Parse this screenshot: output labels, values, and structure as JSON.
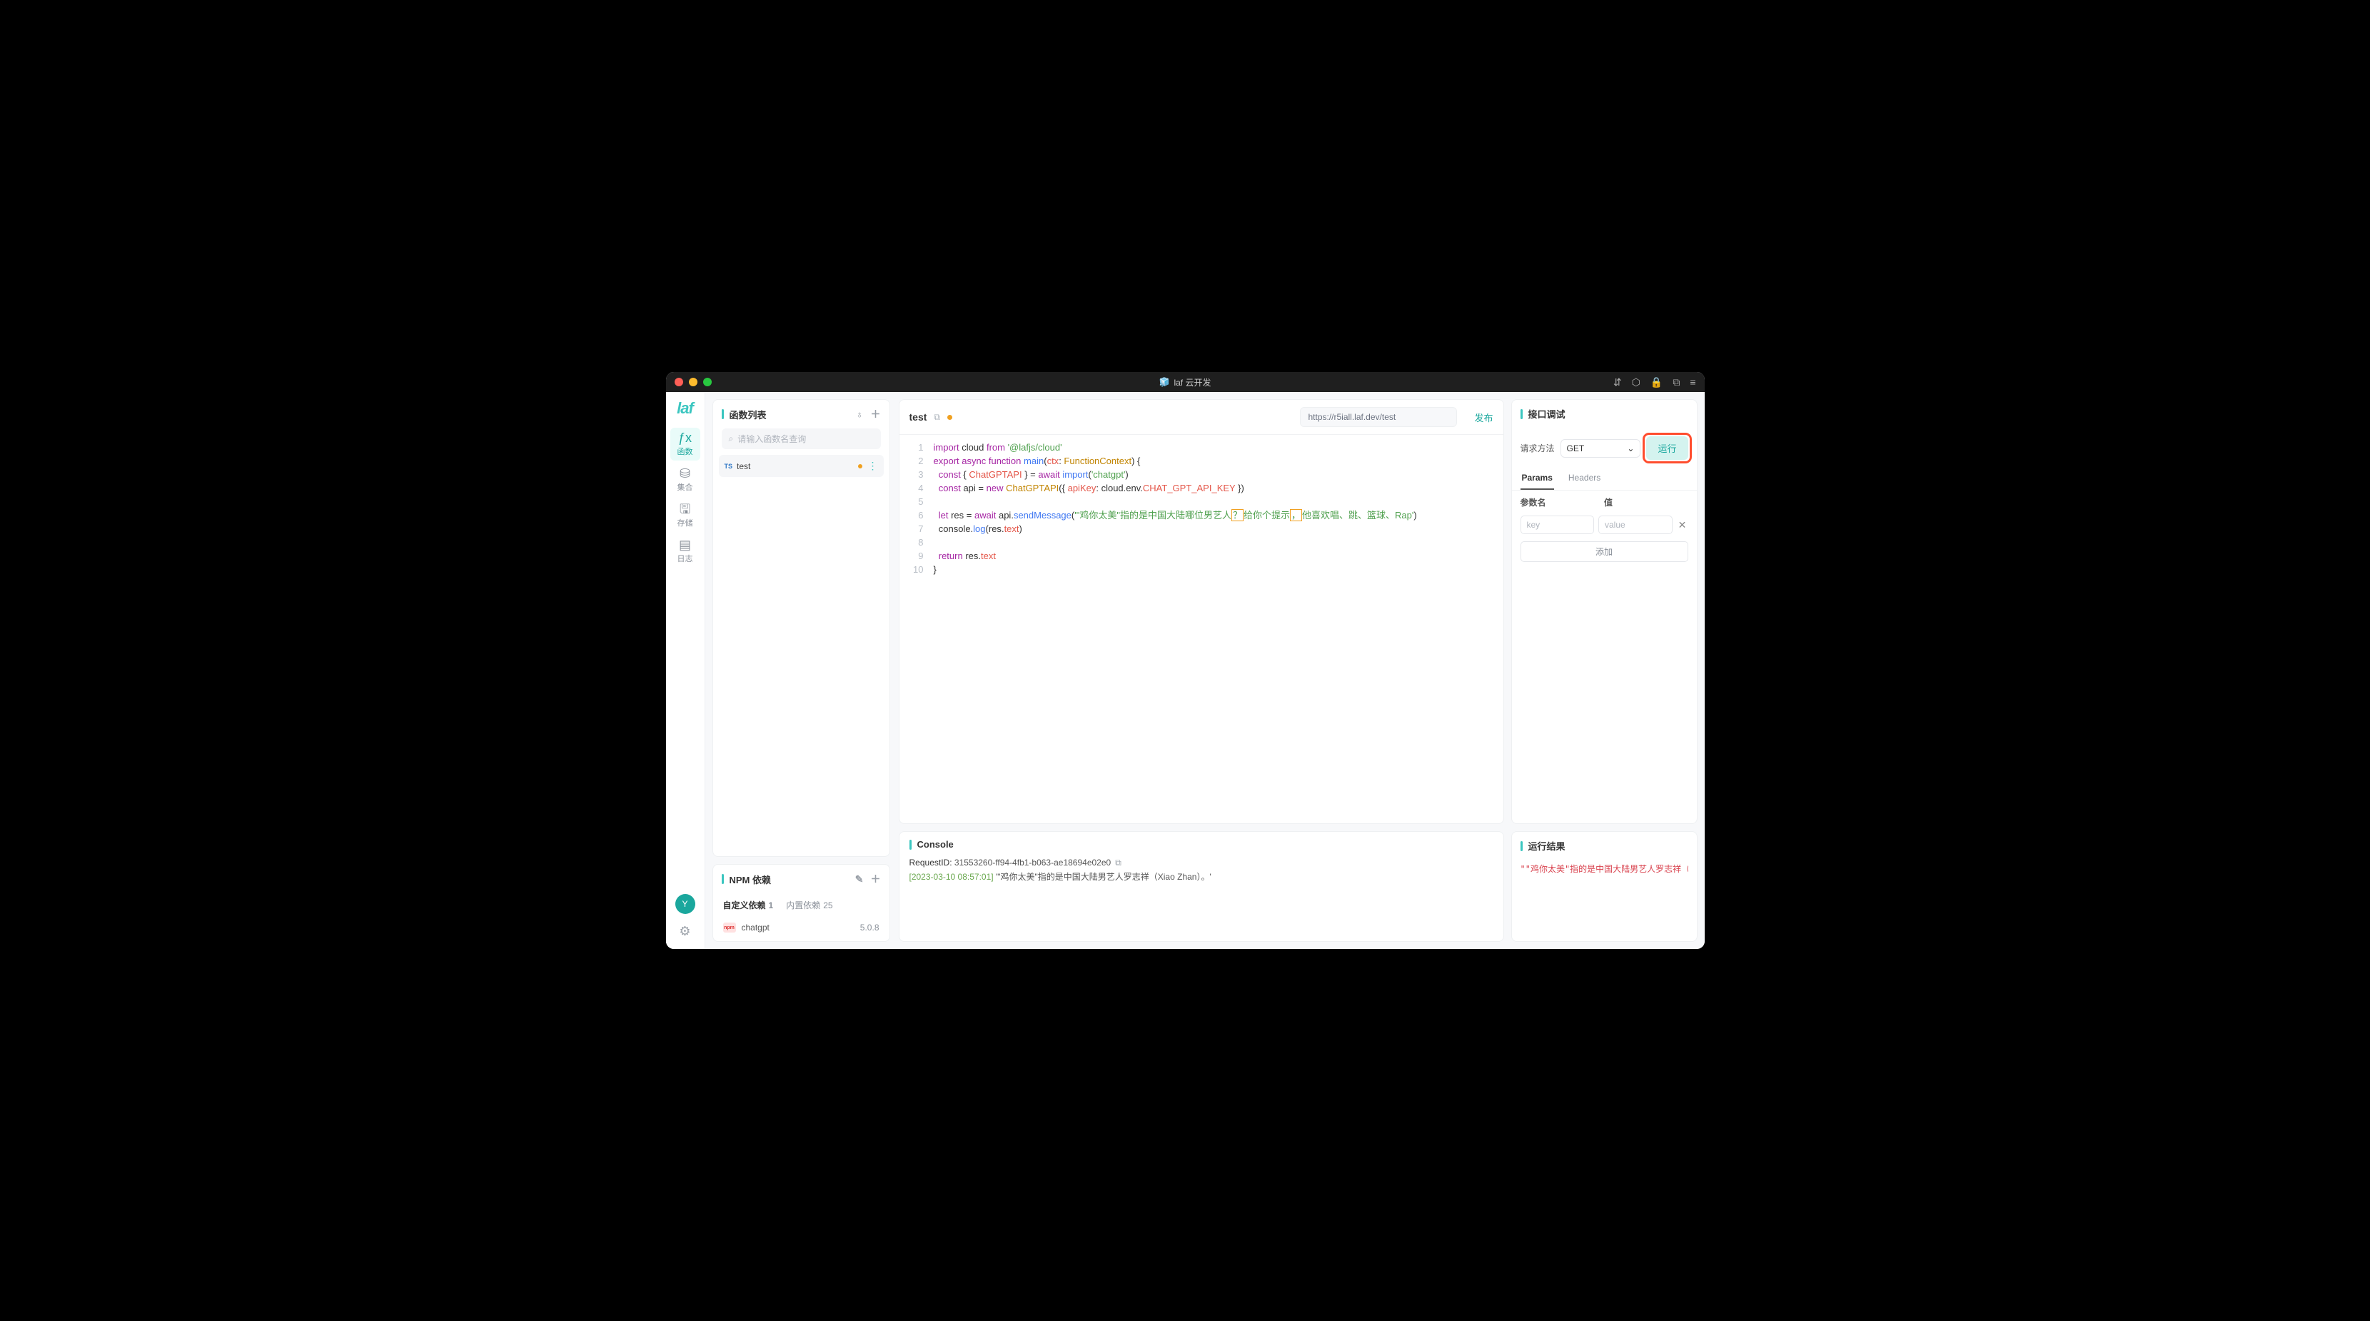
{
  "titlebar": {
    "title": "laf 云开发"
  },
  "rail": {
    "logo": "laf",
    "items": [
      {
        "icon": "fx",
        "label": "函数"
      },
      {
        "icon": "⛁",
        "label": "集合"
      },
      {
        "icon": "🖫",
        "label": "存储"
      },
      {
        "icon": "▤",
        "label": "日志"
      }
    ],
    "avatar": "Y"
  },
  "funcPanel": {
    "title": "函数列表",
    "searchPlaceholder": "请输入函数名查询",
    "items": [
      {
        "lang": "TS",
        "name": "test"
      }
    ]
  },
  "npm": {
    "title": "NPM 依赖",
    "tabs": {
      "custom": "自定义依赖",
      "customCount": "1",
      "builtin": "内置依赖",
      "builtinCount": "25"
    },
    "deps": [
      {
        "name": "chatgpt",
        "version": "5.0.8"
      }
    ]
  },
  "editor": {
    "name": "test",
    "url": "https://r5iall.laf.dev/test",
    "publish": "发布",
    "lines": [
      1,
      2,
      3,
      4,
      5,
      6,
      7,
      8,
      9,
      10
    ]
  },
  "code": {
    "l1a": "import",
    "l1b": "cloud",
    "l1c": "from",
    "l1d": "'@lafjs/cloud'",
    "l2a": "export",
    "l2b": "async",
    "l2c": "function",
    "l2d": "main",
    "l2e": "ctx",
    "l2f": "FunctionContext",
    "l3a": "const",
    "l3b": "ChatGPTAPI",
    "l3c": "await",
    "l3d": "import",
    "l3e": "'chatgpt'",
    "l4a": "const",
    "l4b": "api",
    "l4c": "new",
    "l4d": "ChatGPTAPI",
    "l4e": "apiKey",
    "l4f": "cloud",
    "l4g": "env",
    "l4h": "CHAT_GPT_API_KEY",
    "l6a": "let",
    "l6b": "res",
    "l6c": "await",
    "l6d": "api",
    "l6e": "sendMessage",
    "l6f": "'\"鸡你太美\"指的是中国大陆哪位男艺人",
    "l6g": "？",
    "l6h": "给你个提示",
    "l6i": "，",
    "l6j": "他喜欢唱、跳、篮球、Rap'",
    "l7a": "console",
    "l7b": "log",
    "l7c": "res",
    "l7d": "text",
    "l9a": "return",
    "l9b": "res",
    "l9c": "text"
  },
  "console": {
    "title": "Console",
    "reqLabel": "RequestID: ",
    "reqId": "31553260-ff94-4fb1-b063-ae18694e02e0",
    "ts": "[2023-03-10 08:57:01]",
    "msg": "'\"鸡你太美\"指的是中国大陆男艺人罗志祥（Xiao Zhan）。'"
  },
  "debug": {
    "title": "接口调试",
    "methodLabel": "请求方法",
    "method": "GET",
    "run": "运行",
    "tabs": {
      "params": "Params",
      "headers": "Headers"
    },
    "kv": {
      "keyHead": "参数名",
      "valHead": "值",
      "keyPh": "key",
      "valPh": "value"
    },
    "add": "添加"
  },
  "result": {
    "title": "运行结果",
    "body": "\"\"鸡你太美\"指的是中国大陆男艺人罗志祥（Xiao Z"
  }
}
